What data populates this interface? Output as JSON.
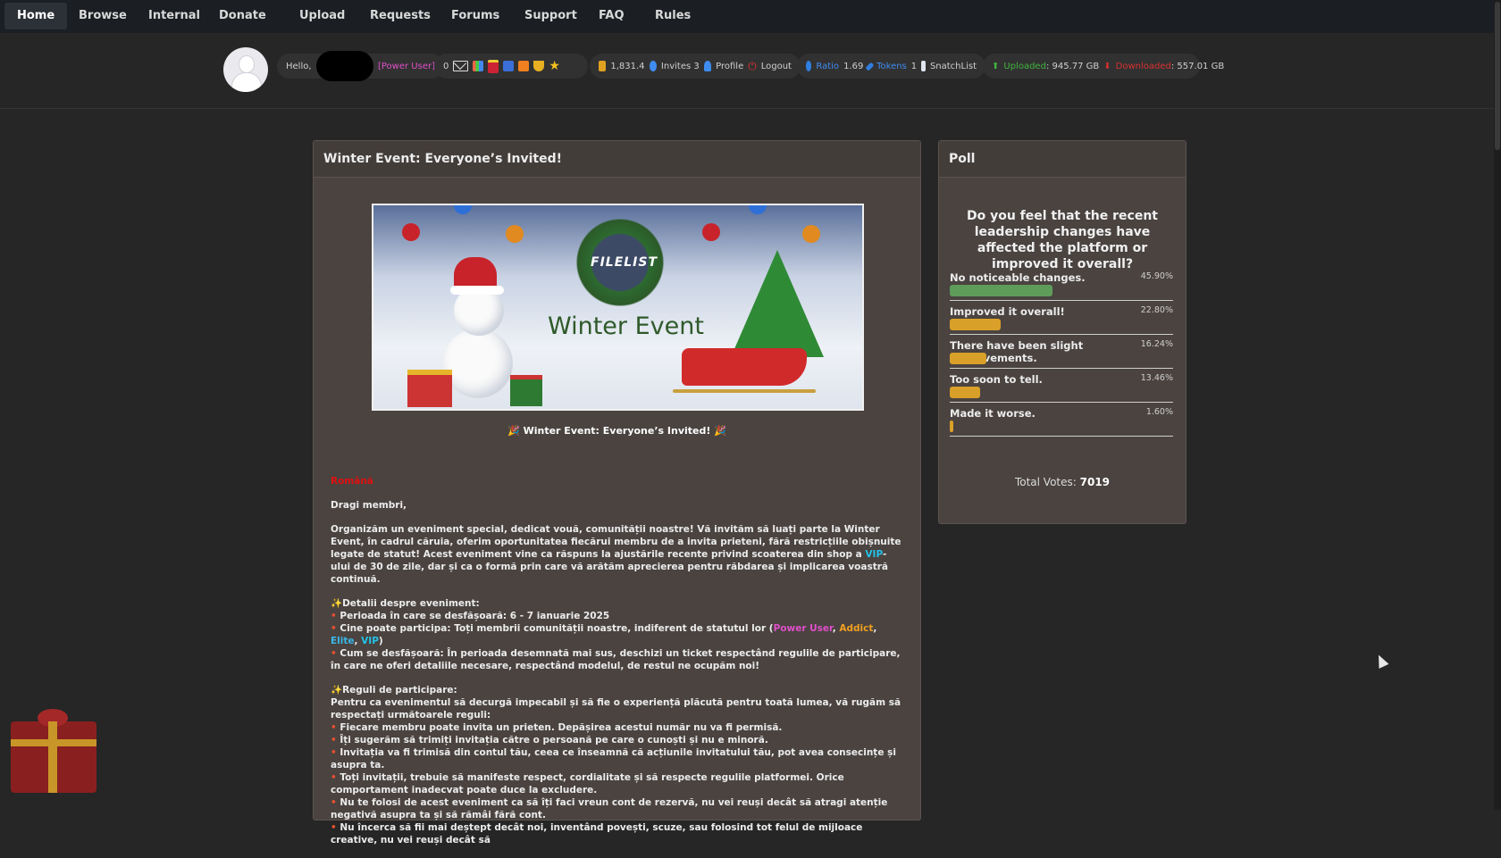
{
  "nav": {
    "items": [
      "Home",
      "Browse",
      "Internal",
      "Donate",
      "Upload",
      "Requests",
      "Forums",
      "Support",
      "FAQ",
      "Rules"
    ]
  },
  "user": {
    "hello": "Hello,",
    "class_label": "[Power User]",
    "messages_count": "0",
    "bonus": "1,831.4",
    "invites_label": "Invites",
    "invites_count": "3",
    "profile": "Profile",
    "logout": "Logout",
    "ratio_label": "Ratio",
    "ratio_value": "1.69",
    "tokens_label": "Tokens",
    "tokens_value": "1",
    "snatchlist": "SnatchList",
    "uploaded_label": "Uploaded",
    "uploaded_value": ": 945.77 GB",
    "downloaded_label": "Downloaded",
    "downloaded_value": ": 557.01 GB"
  },
  "news": {
    "header": "Winter Event: Everyone’s Invited!",
    "banner_logo": "FILELIST",
    "banner_title": "Winter Event",
    "headline": "Winter Event: Everyone’s Invited!",
    "lang": "Română",
    "greeting": "Dragi membri,",
    "intro_a": "Organizăm un eveniment special, dedicat vouă, comunității noastre! Vă invităm să luați parte la Winter Event, în cadrul căruia, oferim oportunitatea fiecărui membru de a invita prieteni, fără restricțiile obișnuite legate de statut! Acest eveniment vine ca răspuns la ajustările recente privind scoaterea din shop a ",
    "intro_vip": "VIP",
    "intro_b": "-ului de 30 de zile, dar și ca o formă prin care vă arătăm aprecierea pentru răbdarea și implicarea voastră continuă.",
    "details_title": "Detalii despre eveniment:",
    "details_period": "Perioada în care se desfășoară: 6 - 7 ianuarie 2025",
    "details_who_a": "Cine poate participa: Toți membrii comunității noastre, indiferent de statutul lor (",
    "class_power": "Power User",
    "class_addict": "Addict",
    "class_elite": "Elite",
    "class_vip": "VIP",
    "details_how": "Cum se desfășoară: În perioada desemnată mai sus, deschizi un ticket respectând regulile de participare, în care ne oferi detaliile necesare, respectând modelul, de restul ne ocupăm noi!",
    "rules_title": "Reguli de participare:",
    "rules_intro": "Pentru ca evenimentul să decurgă impecabil și să fie o experiență plăcută pentru toată lumea, vă rugăm să respectați următoarele reguli:",
    "rules": [
      "Fiecare membru poate invita un prieten. Depășirea acestui număr nu va fi permisă.",
      "Îți sugerăm să trimiți invitația către o persoană pe care o cunoști și nu e minoră.",
      "Invitația va fi trimisă din contul tău, ceea ce înseamnă că acțiunile invitatului tău, pot avea consecințe și asupra ta.",
      "Toți invitații, trebuie să manifeste respect, cordialitate și să respecte regulile platformei. Orice comportament inadecvat poate duce la excludere.",
      "Nu te folosi de acest eveniment ca să îți faci vreun cont de rezervă, nu vei reuși decât să atragi atenție negativă asupra ta și să rămâi fără cont.",
      "Nu încerca să fii mai deștept decât noi, inventând povești, scuze, sau folosind tot felul de mijloace creative, nu vei reuși decât să"
    ]
  },
  "poll": {
    "header": "Poll",
    "question": "Do you feel that the recent leadership changes have affected the platform or improved it overall?",
    "options": [
      {
        "label": "No noticeable changes.",
        "pct": "45.90%",
        "value": 0.459,
        "color": "#5e9c5a"
      },
      {
        "label": "Improved it overall!",
        "pct": "22.80%",
        "value": 0.228,
        "color": "#d9a029"
      },
      {
        "label": "There have been slight improvements.",
        "pct": "16.24%",
        "value": 0.1624,
        "color": "#d9a029"
      },
      {
        "label": "Too soon to tell.",
        "pct": "13.46%",
        "value": 0.1346,
        "color": "#d9a029"
      },
      {
        "label": "Made it worse.",
        "pct": "1.60%",
        "value": 0.016,
        "color": "#d9a029"
      }
    ],
    "total_label": "Total Votes: ",
    "total_value": "7019"
  }
}
